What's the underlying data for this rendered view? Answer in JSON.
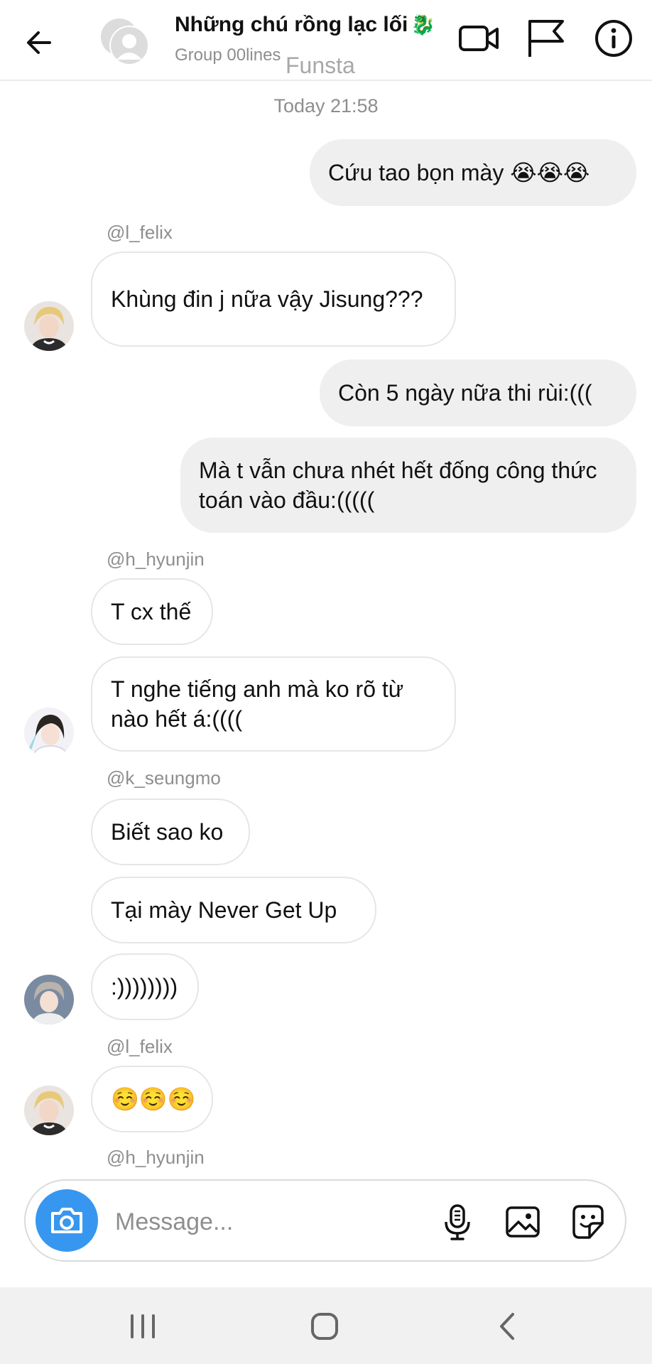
{
  "header": {
    "title": "Những chú rồng lạc lối",
    "title_emoji": "🐉",
    "subtitle": "Group 00lines",
    "watermark": "Funsta",
    "icons": [
      "back-arrow-icon",
      "group-avatar-icon",
      "video-call-icon",
      "flag-icon",
      "info-icon"
    ]
  },
  "chat": {
    "timestamp": "Today 21:58",
    "messages": [
      {
        "from": "me",
        "text": "Cứu tao bọn mày 😭😭😭"
      },
      {
        "from": "@l_felix",
        "text": "Khùng đin j nữa vậy Jisung???"
      },
      {
        "from": "me",
        "text": "Còn 5 ngày nữa thi rùi:((("
      },
      {
        "from": "me",
        "text": "Mà t vẫn chưa nhét hết đống công thức toán vào đầu:((((("
      },
      {
        "from": "@h_hyunjin",
        "text": "T cx thế"
      },
      {
        "from": "@h_hyunjin",
        "text": "T nghe tiếng anh mà ko rõ từ nào hết á:(((("
      },
      {
        "from": "@k_seungmo",
        "text": "Biết sao ko"
      },
      {
        "from": "@k_seungmo",
        "text": "Tại mày Never Get Up"
      },
      {
        "from": "@k_seungmo",
        "text": ":))))))))"
      },
      {
        "from": "@l_felix",
        "text": "☺️☺️☺️"
      }
    ],
    "senders": {
      "felix": "@l_felix",
      "hyunjin": "@h_hyunjin",
      "seungmo": "@k_seungmo",
      "felix2": "@l_felix",
      "hyunjin2": "@h_hyunjin"
    }
  },
  "composer": {
    "placeholder": "Message...",
    "icons": [
      "camera-icon",
      "microphone-icon",
      "gallery-icon",
      "sticker-icon"
    ]
  },
  "colors": {
    "accent": "#3797f0",
    "outgoing_bubble": "#efefef",
    "incoming_border": "#e6e6e6",
    "secondary_text": "#8e8e8e",
    "navbar": "#f1f1f1"
  }
}
